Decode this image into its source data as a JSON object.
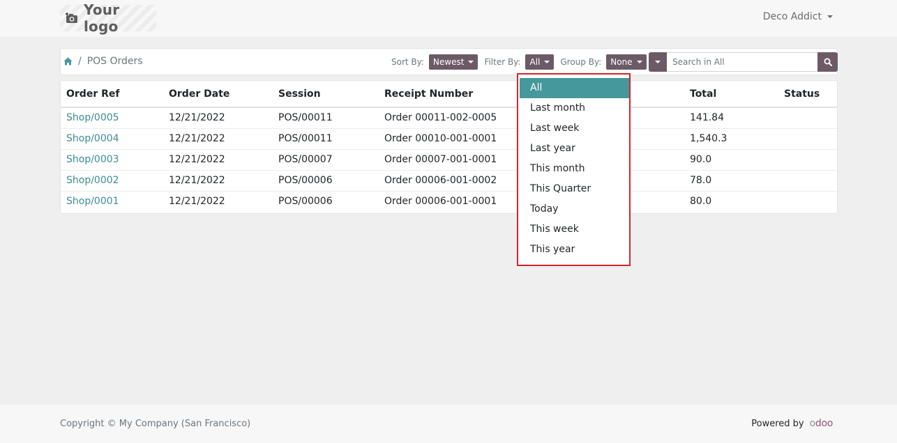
{
  "header": {
    "logo_text": "Your logo",
    "user_name": "Deco Addict"
  },
  "breadcrumb": {
    "current": "POS Orders"
  },
  "toolbar": {
    "sort_label": "Sort By:",
    "sort_value": "Newest",
    "filter_label": "Filter By:",
    "filter_value": "All",
    "group_label": "Group By:",
    "group_value": "None",
    "search_placeholder": "Search in All"
  },
  "table": {
    "columns": [
      "Order Ref",
      "Order Date",
      "Session",
      "Receipt Number",
      "Total",
      "Status"
    ],
    "rows": [
      {
        "ref": "Shop/0005",
        "date": "12/21/2022",
        "session": "POS/00011",
        "receipt": "Order 00011-002-0005",
        "total": "141.84",
        "status": ""
      },
      {
        "ref": "Shop/0004",
        "date": "12/21/2022",
        "session": "POS/00011",
        "receipt": "Order 00010-001-0001",
        "total": "1,540.3",
        "status": ""
      },
      {
        "ref": "Shop/0003",
        "date": "12/21/2022",
        "session": "POS/00007",
        "receipt": "Order 00007-001-0001",
        "total": "90.0",
        "status": ""
      },
      {
        "ref": "Shop/0002",
        "date": "12/21/2022",
        "session": "POS/00006",
        "receipt": "Order 00006-001-0002",
        "total": "78.0",
        "status": ""
      },
      {
        "ref": "Shop/0001",
        "date": "12/21/2022",
        "session": "POS/00006",
        "receipt": "Order 00006-001-0001",
        "total": "80.0",
        "status": ""
      }
    ]
  },
  "filter_dropdown": {
    "selected": "All",
    "options": [
      "All",
      "Last month",
      "Last week",
      "Last year",
      "This month",
      "This Quarter",
      "Today",
      "This week",
      "This year"
    ]
  },
  "footer": {
    "copyright": "Copyright © My Company (San Francisco)",
    "powered_by": "Powered by",
    "odoo_o": "o",
    "odoo_rest": "doo"
  },
  "colors": {
    "accent": "#45989c",
    "link": "#3c8d93",
    "button": "#6d5a67",
    "highlight_border": "#d9232d"
  },
  "icons": {
    "logo": "camera-icon",
    "home": "home-icon",
    "search": "search-icon"
  }
}
